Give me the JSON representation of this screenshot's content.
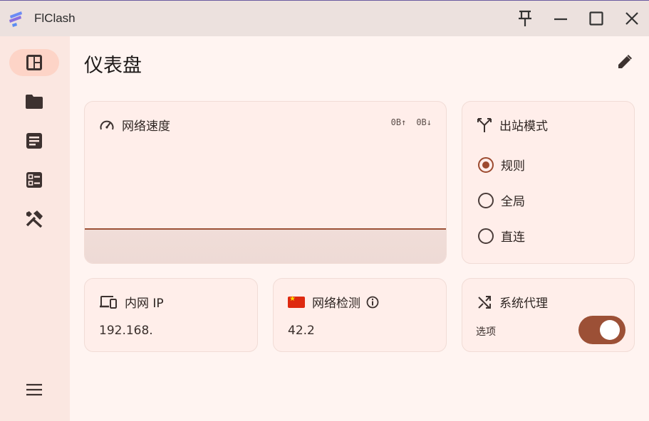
{
  "window": {
    "title": "FlClash",
    "accent": "#9c5036"
  },
  "sidebar": {
    "items": [
      {
        "icon": "dashboard-icon",
        "active": true
      },
      {
        "icon": "folder-icon",
        "active": false
      },
      {
        "icon": "logs-icon",
        "active": false
      },
      {
        "icon": "connections-icon",
        "active": false
      },
      {
        "icon": "tools-icon",
        "active": false
      }
    ],
    "menu_icon": "menu-icon"
  },
  "page": {
    "title": "仪表盘"
  },
  "speed_card": {
    "title": "网络速度",
    "upload": "0B↑",
    "download": "0B↓"
  },
  "mode_card": {
    "title": "出站模式",
    "options": [
      {
        "label": "规则",
        "checked": true
      },
      {
        "label": "全局",
        "checked": false
      },
      {
        "label": "直连",
        "checked": false
      }
    ]
  },
  "ip_card": {
    "title": "内网 IP",
    "value": "192.168."
  },
  "check_card": {
    "title": "网络检测",
    "value": "42.2"
  },
  "proxy_card": {
    "title": "系统代理",
    "subtitle": "选项",
    "enabled": true
  }
}
